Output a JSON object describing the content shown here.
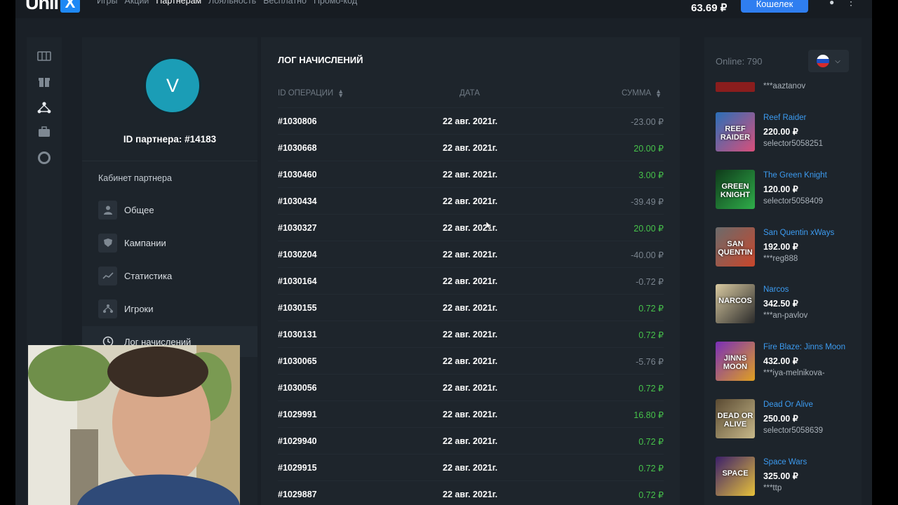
{
  "header": {
    "logo_text": "Unli",
    "logo_x": "X",
    "nav": [
      "Игры",
      "Акции",
      "Партнерам",
      "Лояльность",
      "Бесплатно",
      "Промо-код"
    ],
    "nav_active": 2,
    "balance": "63.69 ₽",
    "wallet_label": "Кошелек"
  },
  "partner": {
    "avatar_letter": "V",
    "id_label": "ID партнера: #14183",
    "cabinet_title": "Кабинет партнера",
    "menu": [
      "Общее",
      "Кампании",
      "Статистика",
      "Игроки",
      "Лог начислений"
    ]
  },
  "log": {
    "title": "ЛОГ НАЧИСЛЕНИЙ",
    "columns": [
      "ID ОПЕРАЦИИ",
      "ДАТА",
      "СУММА"
    ],
    "rows": [
      {
        "id": "#1030806",
        "date": "22 авг. 2021г.",
        "amount": "-23.00 ₽",
        "sign": "neg"
      },
      {
        "id": "#1030668",
        "date": "22 авг. 2021г.",
        "amount": "20.00 ₽",
        "sign": "pos"
      },
      {
        "id": "#1030460",
        "date": "22 авг. 2021г.",
        "amount": "3.00 ₽",
        "sign": "pos"
      },
      {
        "id": "#1030434",
        "date": "22 авг. 2021г.",
        "amount": "-39.49 ₽",
        "sign": "neg"
      },
      {
        "id": "#1030327",
        "date": "22 авг. 2021г.",
        "amount": "20.00 ₽",
        "sign": "pos"
      },
      {
        "id": "#1030204",
        "date": "22 авг. 2021г.",
        "amount": "-40.00 ₽",
        "sign": "neg"
      },
      {
        "id": "#1030164",
        "date": "22 авг. 2021г.",
        "amount": "-0.72 ₽",
        "sign": "neg"
      },
      {
        "id": "#1030155",
        "date": "22 авг. 2021г.",
        "amount": "0.72 ₽",
        "sign": "pos"
      },
      {
        "id": "#1030131",
        "date": "22 авг. 2021г.",
        "amount": "0.72 ₽",
        "sign": "pos"
      },
      {
        "id": "#1030065",
        "date": "22 авг. 2021г.",
        "amount": "-5.76 ₽",
        "sign": "neg"
      },
      {
        "id": "#1030056",
        "date": "22 авг. 2021г.",
        "amount": "0.72 ₽",
        "sign": "pos"
      },
      {
        "id": "#1029991",
        "date": "22 авг. 2021г.",
        "amount": "16.80 ₽",
        "sign": "pos"
      },
      {
        "id": "#1029940",
        "date": "22 авг. 2021г.",
        "amount": "0.72 ₽",
        "sign": "pos"
      },
      {
        "id": "#1029915",
        "date": "22 авг. 2021г.",
        "amount": "0.72 ₽",
        "sign": "pos"
      },
      {
        "id": "#1029887",
        "date": "22 авг. 2021г.",
        "amount": "0.72 ₽",
        "sign": "pos"
      }
    ]
  },
  "sidebar": {
    "online": "Online: 790",
    "top_user": "***aaztanov",
    "wins": [
      {
        "game": "Reef Raider",
        "amount": "220.00 ₽",
        "user": "selector5058251",
        "thumb": "REEF RAIDER",
        "c1": "#2a6fb8",
        "c2": "#d94f7a"
      },
      {
        "game": "The Green Knight",
        "amount": "120.00 ₽",
        "user": "selector5058409",
        "thumb": "GREEN KNIGHT",
        "c1": "#0f3a1a",
        "c2": "#2fae4a"
      },
      {
        "game": "San Quentin xWays",
        "amount": "192.00 ₽",
        "user": "***reg888",
        "thumb": "SAN QUENTIN",
        "c1": "#6b6b6b",
        "c2": "#c9462b"
      },
      {
        "game": "Narcos",
        "amount": "342.50 ₽",
        "user": "***an-pavlov",
        "thumb": "NARCOS",
        "c1": "#d8c9a0",
        "c2": "#2a2a2a"
      },
      {
        "game": "Fire Blaze: Jinns Moon",
        "amount": "432.00 ₽",
        "user": "***iya-melnikova-",
        "thumb": "JINNS MOON",
        "c1": "#7a2fb8",
        "c2": "#e0a020"
      },
      {
        "game": "Dead Or Alive",
        "amount": "250.00 ₽",
        "user": "selector5058639",
        "thumb": "DEAD OR ALIVE",
        "c1": "#5a4a32",
        "c2": "#c8b98a"
      },
      {
        "game": "Space Wars",
        "amount": "325.00 ₽",
        "user": "***ttp",
        "thumb": "SPACE",
        "c1": "#3b1f6b",
        "c2": "#e8c23a"
      }
    ]
  }
}
